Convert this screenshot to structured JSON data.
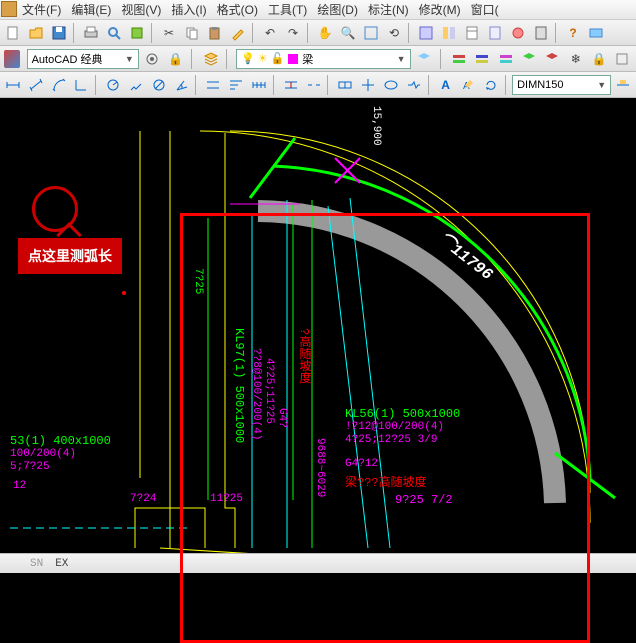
{
  "menu": {
    "file": "文件(F)",
    "edit": "编辑(E)",
    "view": "视图(V)",
    "insert": "插入(I)",
    "format": "格式(O)",
    "tools": "工具(T)",
    "draw": "绘图(D)",
    "dimension": "标注(N)",
    "modify": "修改(M)",
    "window": "窗口("
  },
  "workspace": {
    "label": "AutoCAD 经典"
  },
  "layer": {
    "current": "梁"
  },
  "dimstyle": {
    "current": "DIMN150"
  },
  "annotation": {
    "text": "点这里测弧长"
  },
  "canvas": {
    "arc_dim": "11796",
    "beam1_name": "KL97(1) 500x1000",
    "beam1_rebar1": "??8@100/200(4)",
    "beam1_rebar2": "4?25;11?25",
    "beam1_g": "G4?",
    "beam2_name": "KL56(1) 500x1000",
    "beam2_rebar1": "!?12@100/200(4)",
    "beam2_rebar2": "4?25;12?25  3/9",
    "beam2_g": "G4?12",
    "beam2_note": "梁???高随坡度",
    "beam2_note2": "9?25 7/2",
    "left_beam": "53(1) 400x1000",
    "left_rebar1": "100/200(4)",
    "left_rebar2": "5;7?25",
    "left_val": "12",
    "bottom_dims1": "7?24",
    "bottom_dims2": "11?25",
    "vert_note": "?高随坡度",
    "vert_dim": "7?25",
    "range_dim": "9688~6029",
    "top_dim": "15,900"
  },
  "status": {
    "snap": "SN",
    "ex": "EX"
  }
}
